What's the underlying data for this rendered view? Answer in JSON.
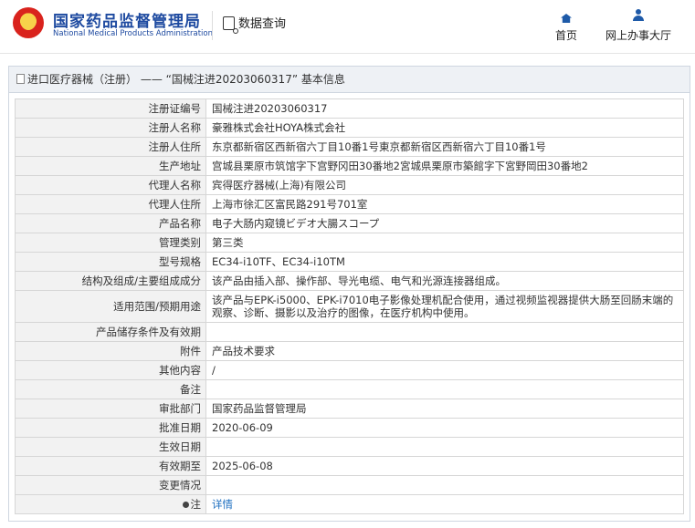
{
  "header": {
    "logo_cn": "国家药品监督管理局",
    "logo_en": "National Medical Products Administration",
    "query_label": "数据查询",
    "nav": [
      {
        "label": "首页",
        "icon": "home-icon"
      },
      {
        "label": "网上办事大厅",
        "icon": "person-icon"
      }
    ]
  },
  "panel": {
    "title": "进口医疗器械（注册） —— “国械注进20203060317” 基本信息"
  },
  "rows": [
    {
      "key": "注册证编号",
      "value": "国械注进20203060317"
    },
    {
      "key": "注册人名称",
      "value": "豪雅株式会社HOYA株式会社"
    },
    {
      "key": "注册人住所",
      "value": "东京都新宿区西新宿六丁目10番1号東京都新宿区西新宿六丁目10番1号"
    },
    {
      "key": "生产地址",
      "value": "宫城县栗原市筑馆字下宫野冈田30番地2宮城県栗原市築館字下宮野岡田30番地2"
    },
    {
      "key": "代理人名称",
      "value": "宾得医疗器械(上海)有限公司"
    },
    {
      "key": "代理人住所",
      "value": "上海市徐汇区富民路291号701室"
    },
    {
      "key": "产品名称",
      "value": "电子大肠内窥镜ビデオ大腸スコープ"
    },
    {
      "key": "管理类别",
      "value": "第三类"
    },
    {
      "key": "型号规格",
      "value": "EC34-i10TF、EC34-i10TM"
    },
    {
      "key": "结构及组成/主要组成成分",
      "value": "该产品由插入部、操作部、导光电缆、电气和光源连接器组成。"
    },
    {
      "key": "适用范围/预期用途",
      "value": "该产品与EPK-i5000、EPK-i7010电子影像处理机配合使用，通过视频监视器提供大肠至回肠末端的观察、诊断、摄影以及治疗的图像，在医疗机构中使用。"
    },
    {
      "key": "产品储存条件及有效期",
      "value": ""
    },
    {
      "key": "附件",
      "value": "产品技术要求"
    },
    {
      "key": "其他内容",
      "value": "/"
    },
    {
      "key": "备注",
      "value": ""
    },
    {
      "key": "审批部门",
      "value": "国家药品监督管理局"
    },
    {
      "key": "批准日期",
      "value": "2020-06-09"
    },
    {
      "key": "生效日期",
      "value": ""
    },
    {
      "key": "有效期至",
      "value": "2025-06-08"
    },
    {
      "key": "变更情况",
      "value": ""
    },
    {
      "key": "注",
      "value": "详情"
    }
  ],
  "colors": {
    "brand_blue": "#1e4aa0",
    "link": "#1e6fc0",
    "key_bg": "#f2f2f2"
  }
}
